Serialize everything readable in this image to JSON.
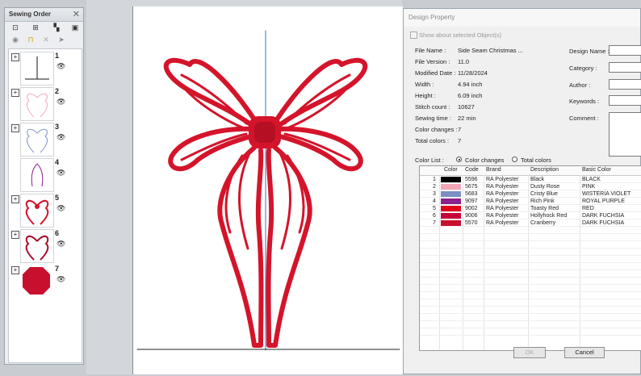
{
  "sewing_panel": {
    "title": "Sewing Order",
    "close": "✕",
    "items": [
      {
        "num": "1"
      },
      {
        "num": "2"
      },
      {
        "num": "3"
      },
      {
        "num": "4"
      },
      {
        "num": "5"
      },
      {
        "num": "6"
      },
      {
        "num": "7"
      }
    ]
  },
  "dialog": {
    "title": "Design Property",
    "show_about_label": "Show about selected Object(s)",
    "info": {
      "file_name_label": "File Name :",
      "file_name": "Side Seam Christmas ...",
      "file_version_label": "File Version :",
      "file_version": "11.0",
      "modified_date_label": "Modified Date :",
      "modified_date": "11/28/2024",
      "width_label": "Width :",
      "width": "4.94 inch",
      "height_label": "Height :",
      "height": "6.09 inch",
      "stitch_count_label": "Stitch count :",
      "stitch_count": "10627",
      "sewing_time_label": "Sewing time :",
      "sewing_time": "22 min",
      "color_changes_label": "Color changes :",
      "color_changes": "7",
      "total_colors_label": "Total colors :",
      "total_colors": "7"
    },
    "right_fields": {
      "design_name_label": "Design Name :",
      "category_label": "Category :",
      "author_label": "Author :",
      "keywords_label": "Keywords :",
      "comment_label": "Comment :"
    },
    "color_list_label": "Color List :",
    "radio_color_changes": "Color changes",
    "radio_total_colors": "Total colors",
    "table": {
      "headers": [
        "Color",
        "Code",
        "Brand",
        "Description",
        "Basic Color"
      ],
      "rows": [
        {
          "idx": "1",
          "hex": "#000000",
          "code": "5596",
          "brand": "RA Polyester",
          "desc": "Black",
          "basic": "BLACK"
        },
        {
          "idx": "2",
          "hex": "#f2a7b8",
          "code": "5675",
          "brand": "RA Polyester",
          "desc": "Dusty Rose",
          "basic": "PINK"
        },
        {
          "idx": "3",
          "hex": "#7b8fc4",
          "code": "5683",
          "brand": "RA Polyester",
          "desc": "Cristy Blue",
          "basic": "WISTERIA VIOLET"
        },
        {
          "idx": "4",
          "hex": "#8b1f8e",
          "code": "9097",
          "brand": "RA Polyester",
          "desc": "Rich Pink",
          "basic": "ROYAL PURPLE"
        },
        {
          "idx": "5",
          "hex": "#e0001b",
          "code": "9002",
          "brand": "RA Polyester",
          "desc": "Toasty Red",
          "basic": "RED"
        },
        {
          "idx": "6",
          "hex": "#c4003a",
          "code": "9006",
          "brand": "RA Polyester",
          "desc": "Hollyhock Red",
          "basic": "DARK FUCHSIA"
        },
        {
          "idx": "7",
          "hex": "#c8102e",
          "code": "5570",
          "brand": "RA Polyester",
          "desc": "Cranberry",
          "basic": "DARK FUCHSIA"
        }
      ]
    },
    "ok_label": "OK",
    "cancel_label": "Cancel"
  },
  "colors": {
    "bow_red": "#d4142a",
    "accent": "#e9041f"
  }
}
